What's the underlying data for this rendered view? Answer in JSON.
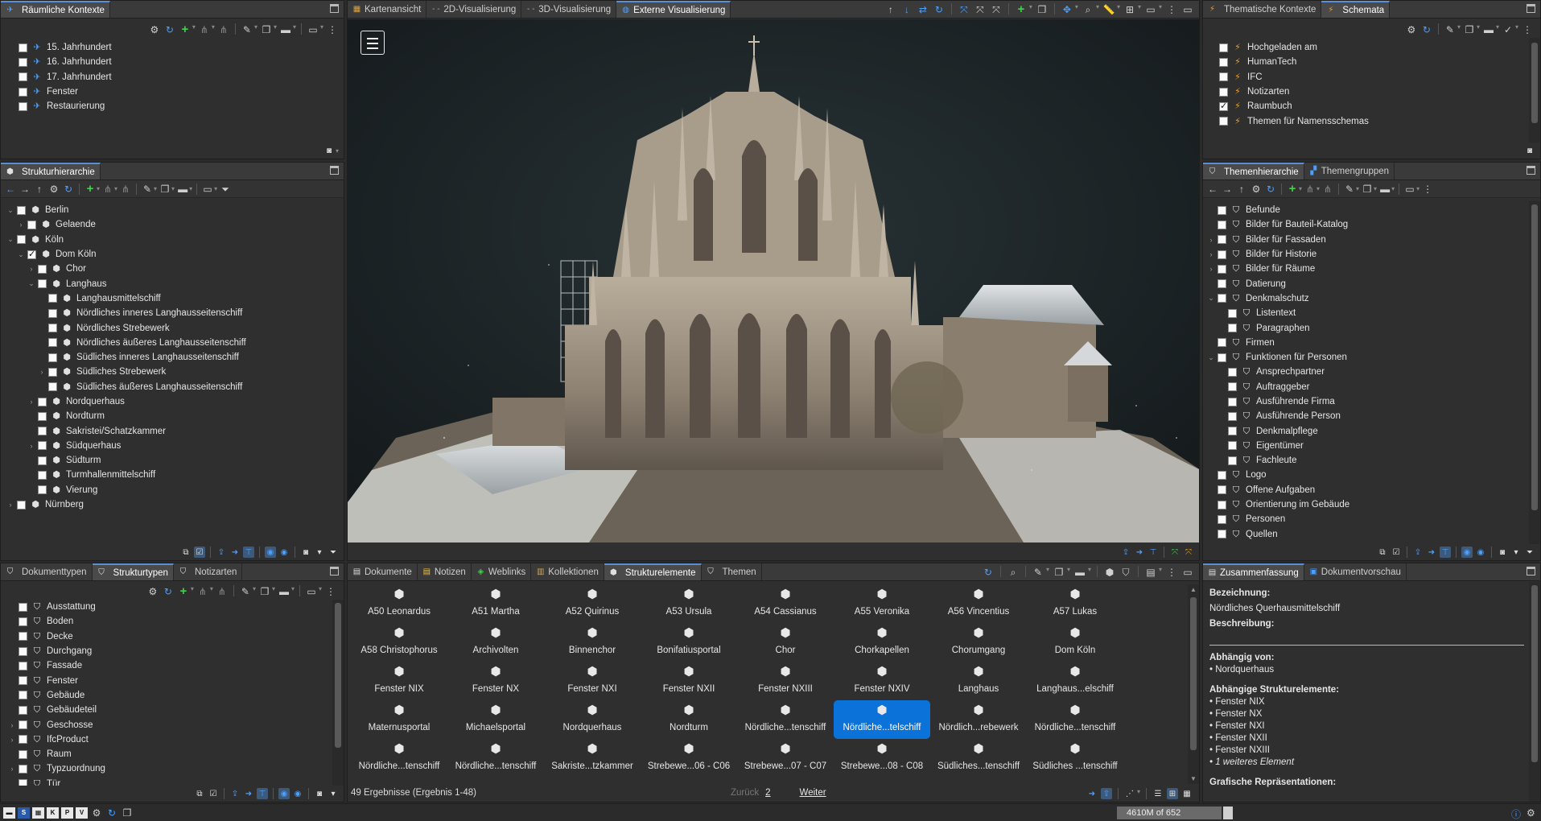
{
  "raeumliche": {
    "tab": "Räumliche Kontexte",
    "items": [
      "15. Jahrhundert",
      "16. Jahrhundert",
      "17. Jahrhundert",
      "Fenster",
      "Restaurierung"
    ]
  },
  "struktur": {
    "tab": "Strukturhierarchie",
    "items": [
      {
        "label": "Berlin",
        "level": 0,
        "exp": "v",
        "checked": false
      },
      {
        "label": "Gelaende",
        "level": 1,
        "exp": ">",
        "checked": false
      },
      {
        "label": "Köln",
        "level": 0,
        "exp": "v",
        "checked": false
      },
      {
        "label": "Dom Köln",
        "level": 1,
        "exp": "v",
        "checked": true
      },
      {
        "label": "Chor",
        "level": 2,
        "exp": ">",
        "checked": false
      },
      {
        "label": "Langhaus",
        "level": 2,
        "exp": "v",
        "checked": false
      },
      {
        "label": "Langhausmittelschiff",
        "level": 3,
        "exp": "",
        "checked": false
      },
      {
        "label": "Nördliches inneres Langhausseitenschiff",
        "level": 3,
        "exp": "",
        "checked": false
      },
      {
        "label": "Nördliches Strebewerk",
        "level": 3,
        "exp": "",
        "checked": false
      },
      {
        "label": "Nördliches äußeres Langhausseitenschiff",
        "level": 3,
        "exp": "",
        "checked": false
      },
      {
        "label": "Südliches inneres Langhausseitenschiff",
        "level": 3,
        "exp": "",
        "checked": false
      },
      {
        "label": "Südliches Strebewerk",
        "level": 3,
        "exp": ">",
        "checked": false
      },
      {
        "label": "Südliches äußeres Langhausseitenschiff",
        "level": 3,
        "exp": "",
        "checked": false
      },
      {
        "label": "Nordquerhaus",
        "level": 2,
        "exp": ">",
        "checked": false
      },
      {
        "label": "Nordturm",
        "level": 2,
        "exp": "",
        "checked": false
      },
      {
        "label": "Sakristei/Schatzkammer",
        "level": 2,
        "exp": "",
        "checked": false
      },
      {
        "label": "Südquerhaus",
        "level": 2,
        "exp": ">",
        "checked": false
      },
      {
        "label": "Südturm",
        "level": 2,
        "exp": "",
        "checked": false
      },
      {
        "label": "Turmhallenmittelschiff",
        "level": 2,
        "exp": "",
        "checked": false
      },
      {
        "label": "Vierung",
        "level": 2,
        "exp": "",
        "checked": false
      },
      {
        "label": "Nürnberg",
        "level": 0,
        "exp": ">",
        "checked": false
      }
    ]
  },
  "typen": {
    "tabs": [
      "Dokumenttypen",
      "Strukturtypen",
      "Notizarten"
    ],
    "items": [
      {
        "label": "Ausstattung",
        "exp": ""
      },
      {
        "label": "Boden",
        "exp": ""
      },
      {
        "label": "Decke",
        "exp": ""
      },
      {
        "label": "Durchgang",
        "exp": ""
      },
      {
        "label": "Fassade",
        "exp": ""
      },
      {
        "label": "Fenster",
        "exp": ""
      },
      {
        "label": "Gebäude",
        "exp": ""
      },
      {
        "label": "Gebäudeteil",
        "exp": ""
      },
      {
        "label": "Geschosse",
        "exp": ">"
      },
      {
        "label": "IfcProduct",
        "exp": ">"
      },
      {
        "label": "Raum",
        "exp": ""
      },
      {
        "label": "Typzuordnung",
        "exp": ">"
      },
      {
        "label": "Tür",
        "exp": ""
      }
    ]
  },
  "viewer": {
    "tabs": [
      "Kartenansicht",
      "2D-Visualisierung",
      "3D-Visualisierung",
      "Externe Visualisierung"
    ]
  },
  "thematisch": {
    "tabs": [
      "Thematische Kontexte",
      "Schemata"
    ],
    "items": [
      {
        "label": "Hochgeladen am",
        "checked": false
      },
      {
        "label": "HumanTech",
        "checked": false
      },
      {
        "label": "IFC",
        "checked": false
      },
      {
        "label": "Notizarten",
        "checked": false
      },
      {
        "label": "Raumbuch",
        "checked": true
      },
      {
        "label": "Themen für Namensschemas",
        "checked": false
      }
    ]
  },
  "themen": {
    "tabs": [
      "Themenhierarchie",
      "Themengruppen"
    ],
    "items": [
      {
        "label": "Befunde",
        "level": 0,
        "exp": ""
      },
      {
        "label": "Bilder für Bauteil-Katalog",
        "level": 0,
        "exp": ""
      },
      {
        "label": "Bilder für Fassaden",
        "level": 0,
        "exp": ">"
      },
      {
        "label": "Bilder für Historie",
        "level": 0,
        "exp": ">"
      },
      {
        "label": "Bilder für Räume",
        "level": 0,
        "exp": ">"
      },
      {
        "label": "Datierung",
        "level": 0,
        "exp": ""
      },
      {
        "label": "Denkmalschutz",
        "level": 0,
        "exp": "v"
      },
      {
        "label": "Listentext",
        "level": 1,
        "exp": ""
      },
      {
        "label": "Paragraphen",
        "level": 1,
        "exp": ""
      },
      {
        "label": "Firmen",
        "level": 0,
        "exp": ""
      },
      {
        "label": "Funktionen für Personen",
        "level": 0,
        "exp": "v"
      },
      {
        "label": "Ansprechpartner",
        "level": 1,
        "exp": ""
      },
      {
        "label": "Auftraggeber",
        "level": 1,
        "exp": ""
      },
      {
        "label": "Ausführende Firma",
        "level": 1,
        "exp": ""
      },
      {
        "label": "Ausführende Person",
        "level": 1,
        "exp": ""
      },
      {
        "label": "Denkmalpflege",
        "level": 1,
        "exp": ""
      },
      {
        "label": "Eigentümer",
        "level": 1,
        "exp": ""
      },
      {
        "label": "Fachleute",
        "level": 1,
        "exp": ""
      },
      {
        "label": "Logo",
        "level": 0,
        "exp": ""
      },
      {
        "label": "Offene Aufgaben",
        "level": 0,
        "exp": ""
      },
      {
        "label": "Orientierung im Gebäude",
        "level": 0,
        "exp": ""
      },
      {
        "label": "Personen",
        "level": 0,
        "exp": ""
      },
      {
        "label": "Quellen",
        "level": 0,
        "exp": ""
      }
    ]
  },
  "results": {
    "tabs": [
      "Dokumente",
      "Notizen",
      "Weblinks",
      "Kollektionen",
      "Strukturelemente",
      "Themen"
    ],
    "items": [
      "A50 Leonardus",
      "A51 Martha",
      "A52 Quirinus",
      "A53 Ursula",
      "A54 Cassianus",
      "A55 Veronika",
      "A56 Vincentius",
      "A57 Lukas",
      "A58 Christophorus",
      "Archivolten",
      "Binnenchor",
      "Bonifatiusportal",
      "Chor",
      "Chorkapellen",
      "Chorumgang",
      "Dom Köln",
      "Fenster NIX",
      "Fenster NX",
      "Fenster NXI",
      "Fenster NXII",
      "Fenster NXIII",
      "Fenster NXIV",
      "Langhaus",
      "Langhaus...elschiff",
      "Maternusportal",
      "Michaelsportal",
      "Nordquerhaus",
      "Nordturm",
      "Nördliche...tenschiff",
      "Nördliche...telschiff",
      "Nördlich...rebewerk",
      "Nördliche...tenschiff",
      "Nördliche...tenschiff",
      "Nördliche...tenschiff",
      "Sakriste...tzkammer",
      "Strebewe...06 - C06",
      "Strebewe...07 - C07",
      "Strebewe...08 - C08",
      "Südliches...tenschiff",
      "Südliches ...tenschiff"
    ],
    "selected_index": 29,
    "count_text": "49 Ergebnisse (Ergebnis 1-48)",
    "back": "Zurück",
    "page": "2",
    "next": "Weiter"
  },
  "summary": {
    "tabs": [
      "Zusammenfassung",
      "Dokumentvorschau"
    ],
    "bez_label": "Bezeichnung:",
    "bez_value": "Nördliches Querhausmittelschiff",
    "beschr_label": "Beschreibung:",
    "abh_label": "Abhängig von:",
    "abh_items": [
      "• Nordquerhaus"
    ],
    "abh2_label": "Abhängige Strukturelemente:",
    "abh2_items": [
      "• Fenster NIX",
      "• Fenster NX",
      "• Fenster NXI",
      "• Fenster NXII",
      "• Fenster NXIII"
    ],
    "more": "• 1 weiteres Element",
    "graf_label": "Grafische Repräsentationen:"
  },
  "status": {
    "memory": "4610M of 652"
  }
}
